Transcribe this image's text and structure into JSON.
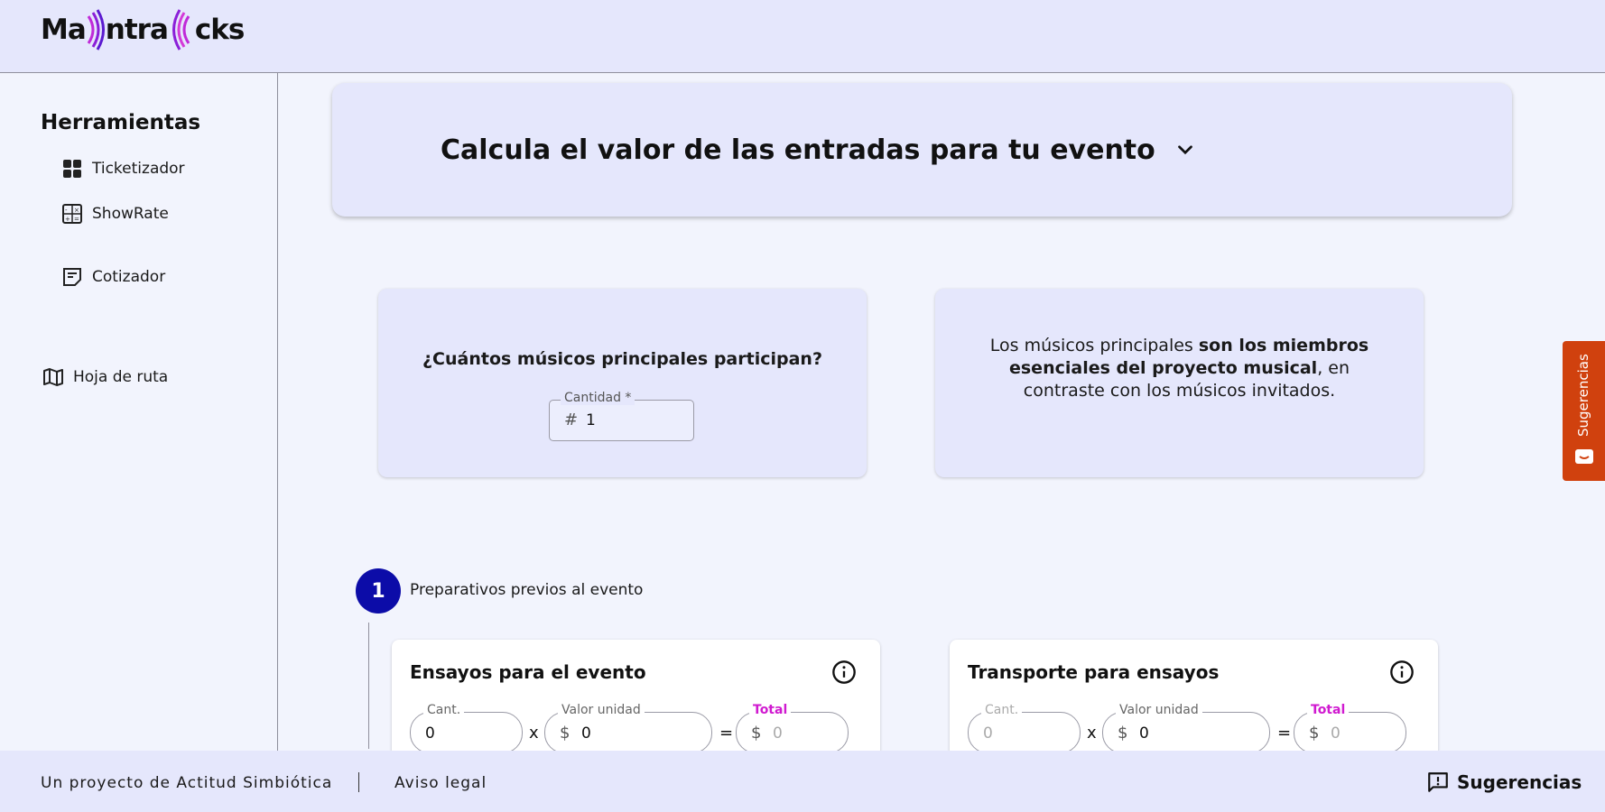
{
  "header": {
    "logo_left": "Ma",
    "logo_mid": "ntra",
    "logo_right": "cks"
  },
  "sidebar": {
    "title": "Herramientas",
    "items": [
      {
        "label": "Ticketizador",
        "icon": "grid-icon"
      },
      {
        "label": "ShowRate",
        "icon": "calculator-icon"
      },
      {
        "label": "Cotizador",
        "icon": "note-icon"
      },
      {
        "label": "Hoja de ruta",
        "icon": "map-icon"
      }
    ]
  },
  "hero": {
    "title": "Calcula el valor de las entradas para tu evento"
  },
  "musicians": {
    "question": "¿Cuántos músicos principales participan?",
    "field_label": "Cantidad *",
    "field_prefix": "#",
    "field_value": "1"
  },
  "info": {
    "text_1": "Los músicos principales ",
    "text_bold": "son los miembros esenciales del proyecto musical",
    "text_2": ", en contraste con los músicos invitados."
  },
  "step": {
    "number": "1",
    "label": "Preparativos previos al evento"
  },
  "cost_cards": [
    {
      "title": "Ensayos para el evento",
      "qty_label": "Cant.",
      "qty_value": "0",
      "unit_label": "Valor unidad",
      "unit_prefix": "$",
      "unit_value": "0",
      "total_label": "Total",
      "total_prefix": "$",
      "total_value": "0",
      "op_mult": "x",
      "op_eq": "="
    },
    {
      "title": "Transporte para ensayos",
      "qty_label": "Cant.",
      "qty_value": "0",
      "unit_label": "Valor unidad",
      "unit_prefix": "$",
      "unit_value": "0",
      "total_label": "Total",
      "total_prefix": "$",
      "total_value": "0",
      "op_mult": "x",
      "op_eq": "="
    }
  ],
  "footer": {
    "credit": "Un proyecto de Actitud Simbiótica",
    "legal": "Aviso legal",
    "feedback": "Sugerencias"
  },
  "feedback_tab": {
    "label": "Sugerencias"
  },
  "colors": {
    "accent": "#0c0ca8",
    "total_label": "#d01ad0",
    "feedback_tab": "#d0410e",
    "logo_wave": "#9b1de0"
  }
}
